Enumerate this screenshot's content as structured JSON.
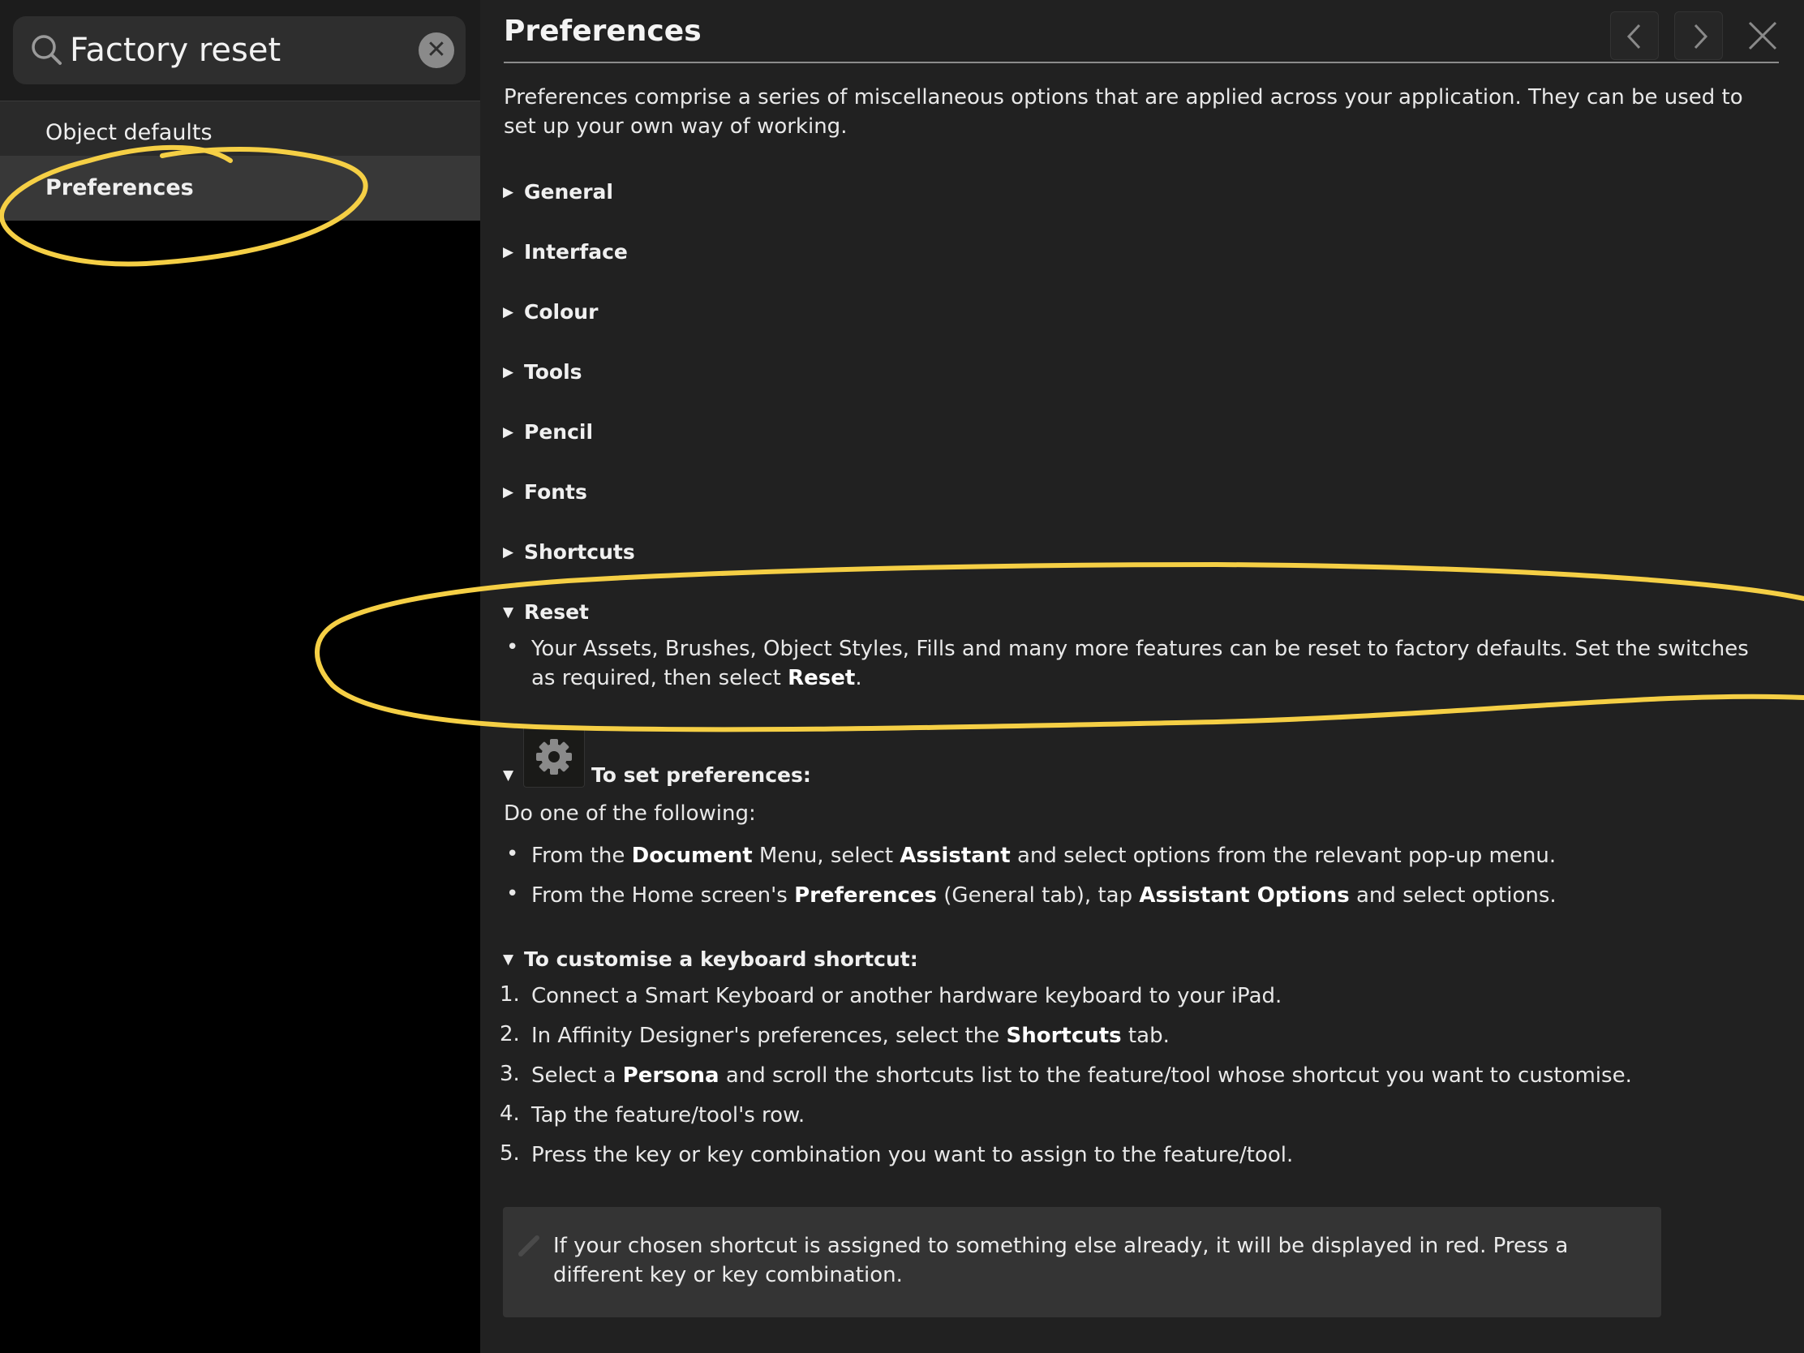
{
  "search": {
    "value": "Factory reset"
  },
  "sidebar": {
    "items": [
      {
        "label": "Object defaults"
      },
      {
        "label": "Preferences"
      }
    ]
  },
  "content": {
    "title": "Preferences",
    "intro": "Preferences comprise a series of miscellaneous options that are applied across your application. They can be used to set up your own way of working.",
    "sections": [
      {
        "label": "General",
        "expanded": false
      },
      {
        "label": "Interface",
        "expanded": false
      },
      {
        "label": "Colour",
        "expanded": false
      },
      {
        "label": "Tools",
        "expanded": false
      },
      {
        "label": "Pencil",
        "expanded": false
      },
      {
        "label": "Fonts",
        "expanded": false
      },
      {
        "label": "Shortcuts",
        "expanded": false
      },
      {
        "label": "Reset",
        "expanded": true
      }
    ],
    "reset_text_a": "Your Assets, Brushes, Object Styles, Fills and many more features can be reset to factory defaults. Set the switches as required, then select ",
    "reset_text_bold": "Reset",
    "reset_text_b": ".",
    "set_prefs": {
      "heading": "To set preferences:",
      "lead": "Do one of the following:",
      "item1": {
        "a": "From the ",
        "b1": "Document",
        "c": " Menu, select ",
        "b2": "Assistant",
        "d": " and select options from the relevant pop-up menu."
      },
      "item2": {
        "a": "From the Home screen's ",
        "b1": "Preferences",
        "c": " (General tab), tap ",
        "b2": "Assistant Options",
        "d": " and select options."
      }
    },
    "shortcut": {
      "heading": "To customise a keyboard shortcut:",
      "steps": [
        {
          "n": "1.",
          "a": "Connect a Smart Keyboard or another hardware keyboard to your iPad.",
          "b": "",
          "c": ""
        },
        {
          "n": "2.",
          "a": "In Affinity Designer's preferences, select the ",
          "b": "Shortcuts",
          "c": " tab."
        },
        {
          "n": "3.",
          "a": "Select a ",
          "b": "Persona",
          "c": " and scroll the shortcuts list to the feature/tool whose shortcut you want to customise."
        },
        {
          "n": "4.",
          "a": "Tap the feature/tool's row.",
          "b": "",
          "c": ""
        },
        {
          "n": "5.",
          "a": "Press the key or key combination you want to assign to the feature/tool.",
          "b": "",
          "c": ""
        }
      ]
    },
    "note": "If your chosen shortcut is assigned to something else already, it will be displayed in red. Press a different key or key combination."
  },
  "colors": {
    "highlight": "#f5cf45",
    "panel": "#212121",
    "sidebar_selected": "#383838"
  },
  "icons": [
    "search-icon",
    "clear-icon",
    "back-arrow-icon",
    "forward-arrow-icon",
    "close-icon",
    "gear-icon",
    "pencil-icon"
  ]
}
